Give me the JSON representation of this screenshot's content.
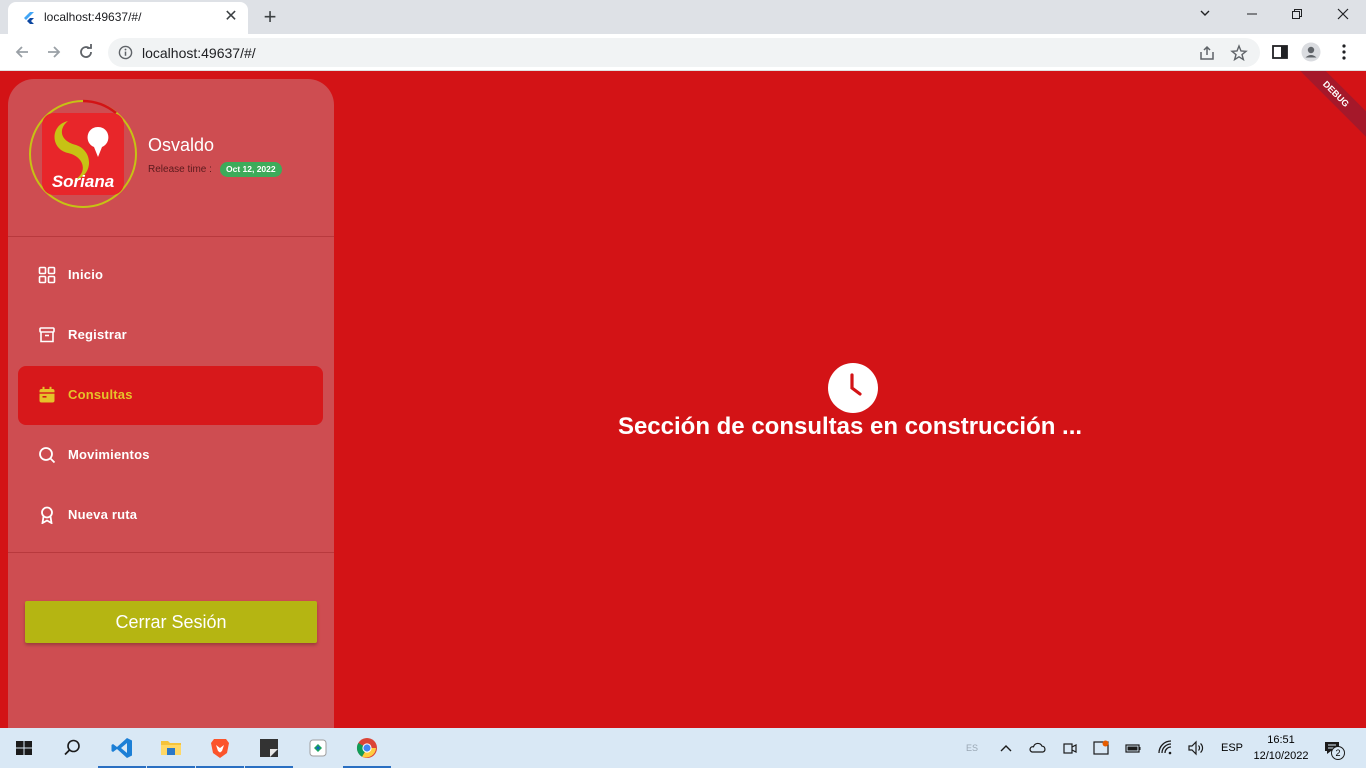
{
  "browser": {
    "tab_title": "localhost:49637/#/",
    "url": "localhost:49637/#/"
  },
  "profile": {
    "logo_text": "Soriana",
    "name": "Osvaldo",
    "release_label": "Release time :",
    "release_date": "Oct 12, 2022"
  },
  "menu": {
    "items": [
      {
        "label": "Inicio",
        "icon": "grid-icon"
      },
      {
        "label": "Registrar",
        "icon": "archive-icon"
      },
      {
        "label": "Consultas",
        "icon": "calendar-icon",
        "active": true
      },
      {
        "label": "Movimientos",
        "icon": "search-icon"
      },
      {
        "label": "Nueva ruta",
        "icon": "award-icon"
      }
    ]
  },
  "logout_label": "Cerrar Sesión",
  "main": {
    "message": "Sección de consultas en construcción ..."
  },
  "debug_banner": "DEBUG",
  "taskbar": {
    "lang_small": "ES",
    "lang": "ESP",
    "time": "16:51",
    "date": "12/10/2022",
    "notifications": "2"
  },
  "colors": {
    "background": "#d31316",
    "sidebar": "#ce4d51",
    "active_text": "#e6c22a",
    "logout": "#b5b512",
    "badge": "#3dab5a"
  }
}
